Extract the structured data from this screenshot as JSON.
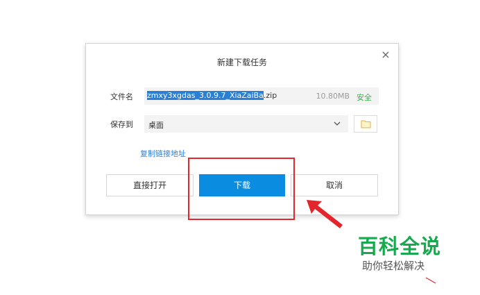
{
  "dialog": {
    "title": "新建下载任务",
    "close_label": "×",
    "filename_label": "文件名",
    "filename_selected": "zmxy3xgdas_3.0.9.7_XiaZaiBa",
    "filename_ext": ".zip",
    "file_size": "10.80MB",
    "safe_badge": "安全",
    "saveto_label": "保存到",
    "saveto_value": "桌面",
    "copy_link": "复制链接地址",
    "buttons": {
      "open": "直接打开",
      "download": "下载",
      "cancel": "取消"
    }
  },
  "watermark": {
    "title": "百科全说",
    "subtitle": "助你轻松解决"
  },
  "colors": {
    "accent": "#0a8de0",
    "highlight": "#e2262b",
    "safe": "#3cae4a",
    "brand": "#16a94e"
  },
  "icons": [
    "close-icon",
    "chevron-down-icon",
    "folder-icon",
    "red-arrow-icon"
  ]
}
